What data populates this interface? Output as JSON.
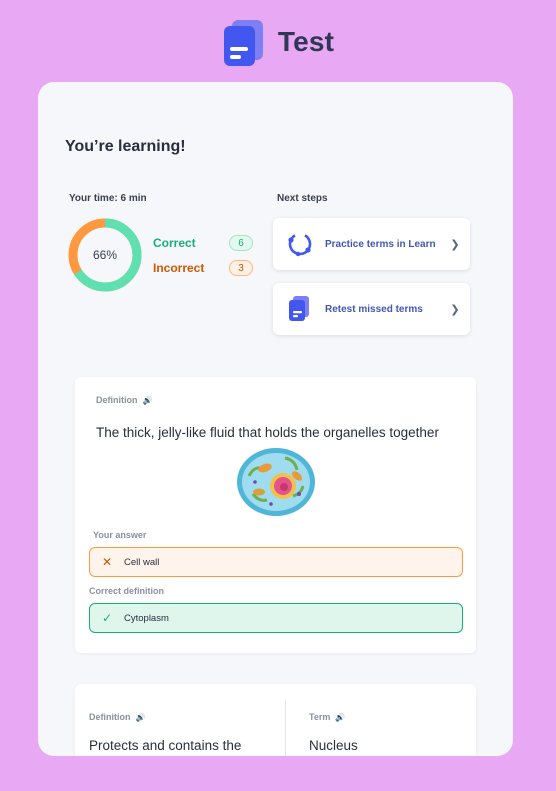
{
  "header": {
    "title": "Test",
    "logo_icon": "test-document-icon"
  },
  "summary": {
    "title": "You’re learning!",
    "time_label": "Your time: 6 min",
    "score_label": "66%",
    "score_percent": 66,
    "correct_label": "Correct",
    "correct_count": "6",
    "incorrect_label": "Incorrect",
    "incorrect_count": "3",
    "colors": {
      "correct": "#18ae79",
      "incorrect": "#ff983f",
      "donut_correct": "#5fe0b0"
    }
  },
  "next_steps": {
    "label": "Next steps",
    "items": [
      {
        "label": "Practice terms in Learn",
        "icon": "learn-cycle-icon"
      },
      {
        "label": "Retest missed terms",
        "icon": "test-document-icon"
      }
    ]
  },
  "question1": {
    "prompt_label": "Definition",
    "prompt": "The thick, jelly-like fluid that holds the organelles together",
    "image_icon": "cell-diagram-icon",
    "your_answer_label": "Your answer",
    "your_answer": "Cell wall",
    "correct_label": "Correct definition",
    "correct_answer": "Cytoplasm"
  },
  "question2": {
    "definition_label": "Definition",
    "definition": "Protects and contains the",
    "term_label": "Term",
    "term": "Nucleus"
  }
}
